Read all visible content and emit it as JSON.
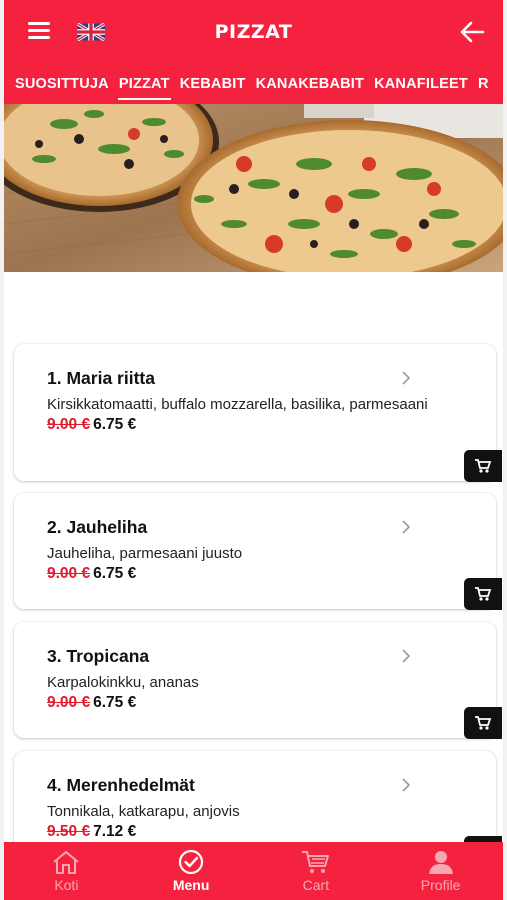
{
  "header": {
    "title": "PIZZAT"
  },
  "tabs": [
    {
      "label": "SUOSITTUJA",
      "active": false
    },
    {
      "label": "PIZZAT",
      "active": true
    },
    {
      "label": "KEBABIT",
      "active": false
    },
    {
      "label": "KANAKEBABIT",
      "active": false
    },
    {
      "label": "KANAFILEET",
      "active": false
    },
    {
      "label": "R",
      "active": false
    }
  ],
  "menu_items": [
    {
      "name": "1. Maria riitta",
      "description": "Kirsikkatomaatti, buffalo mozzarella, basilika, parmesaani",
      "old_price": "9.00 €",
      "price": "6.75 €"
    },
    {
      "name": "2. Jauheliha",
      "description": "Jauheliha, parmesaani juusto",
      "old_price": "9.00 €",
      "price": "6.75 €"
    },
    {
      "name": "3. Tropicana",
      "description": "Karpalokinkku, ananas",
      "old_price": "9.00 €",
      "price": "6.75 €"
    },
    {
      "name": "4. Merenhedelmät",
      "description": "Tonnikala, katkarapu, anjovis",
      "old_price": "9.50 €",
      "price": "7.12 €"
    }
  ],
  "bottom_nav": [
    {
      "label": "Koti",
      "icon": "home-icon",
      "active": false
    },
    {
      "label": "Menu",
      "icon": "check-circle-icon",
      "active": true
    },
    {
      "label": "Cart",
      "icon": "cart-icon",
      "active": false
    },
    {
      "label": "Profile",
      "icon": "person-icon",
      "active": false
    }
  ],
  "colors": {
    "primary": "#f5223f",
    "old_price": "#e21b2c",
    "cart_button": "#111111"
  }
}
